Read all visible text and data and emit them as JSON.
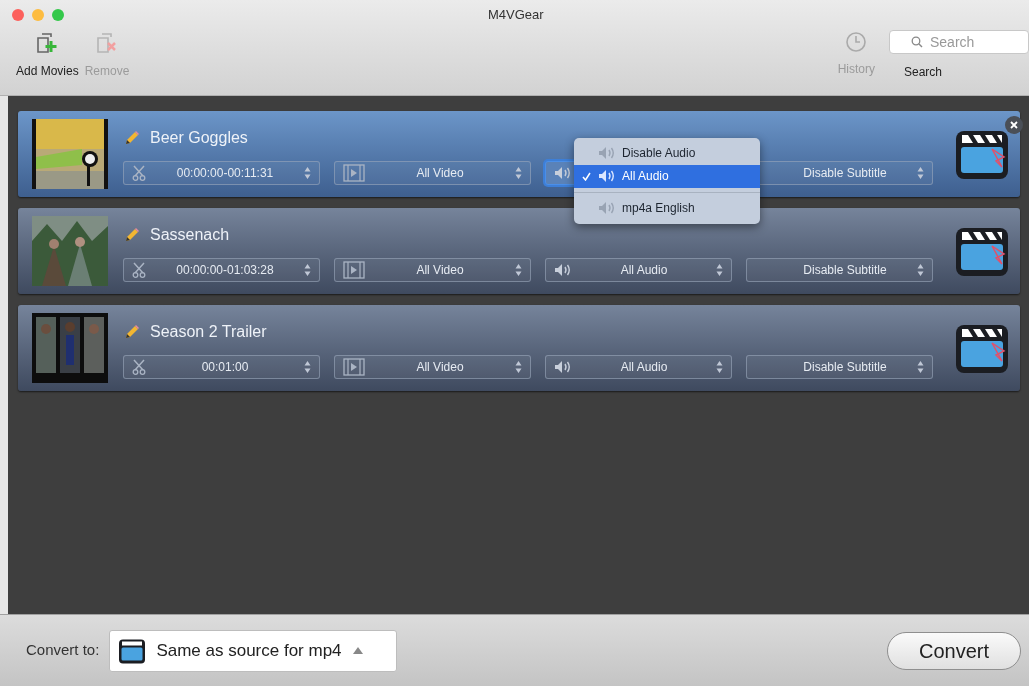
{
  "window": {
    "title": "M4VGear"
  },
  "toolbar": {
    "buttons": [
      {
        "kind": "add",
        "label": "Add Movies",
        "disabled": false
      },
      {
        "kind": "remove",
        "label": "Remove",
        "disabled": true
      }
    ],
    "history": {
      "label": "History",
      "disabled": true
    },
    "search": {
      "placeholder": "Search",
      "label": "Search"
    }
  },
  "movies": [
    {
      "title": "Beer Goggles",
      "selected": true,
      "trim": "00:00:00-00:11:31",
      "video": "All Video",
      "subtitle": "Disable Subtitle",
      "audio_open": true
    },
    {
      "title": "Sassenach",
      "selected": false,
      "trim": "00:00:00-01:03:28",
      "video": "All Video",
      "audio": "All Audio",
      "subtitle": "Disable Subtitle",
      "audio_open": false
    },
    {
      "title": "Season 2 Trailer",
      "selected": false,
      "trim": "00:01:00",
      "video": "All Video",
      "audio": "All Audio",
      "subtitle": "Disable Subtitle",
      "audio_open": false
    }
  ],
  "audio_menu": {
    "items": [
      {
        "kind": "option",
        "label": "Disable Audio",
        "selected": false
      },
      {
        "kind": "option",
        "label": "All Audio",
        "selected": true
      },
      {
        "kind": "separator"
      },
      {
        "kind": "option",
        "label": "mp4a English",
        "selected": false
      }
    ]
  },
  "bottom": {
    "label": "Convert to:",
    "format": "Same as source for mp4",
    "button": "Convert"
  }
}
